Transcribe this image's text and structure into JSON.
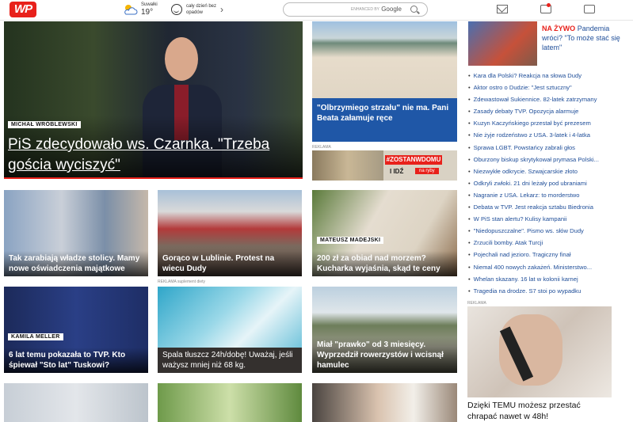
{
  "header": {
    "weather_city": "Suwałki",
    "weather_temp": "19°",
    "weather_desc": "cały dzień bez opadów",
    "search_powered": "ENHANCED BY",
    "search_engine": "Google"
  },
  "colors": {
    "brand": "#e8211b",
    "link": "#1f4e99",
    "caption_blue": "#1f57a7"
  },
  "icons": [
    "wp-logo",
    "weather-sun-cloud-icon",
    "smile-icon",
    "chevron-right-icon",
    "search-icon",
    "mail-icon",
    "notification-icon",
    "tv-icon"
  ],
  "brand": {
    "logo": "WP"
  },
  "hero": {
    "author": "MICHAŁ WRÓBLEWSKI",
    "title": "PiS zdecydowało ws. Czarnka. \"Trzeba gościa wyciszyć\""
  },
  "beach": {
    "caption": "\"Olbrzymiego strzału\" nie ma. Pani Beata załamuje ręce"
  },
  "ad_banner": {
    "reklama": "REKLAMA",
    "hashtag": "#ZOSTANWDOMU",
    "text": "I IDŹ",
    "cta": "na ryby"
  },
  "live": {
    "label": "NA ŻYWO",
    "text": "Pandemia wróci? \"To może stać się latem\""
  },
  "right_news": [
    "Kara dla Polski? Reakcja na słowa Dudy",
    "Aktor ostro o Dudzie: \"Jest sztuczny\"",
    "Zdewastował Sukiennice. 82-latek zatrzymany",
    "Zasady debaty TVP. Opozycja alarmuje",
    "Kuzyn Kaczyńskiego przestał być prezesem",
    "Nie żyje rodzeństwo z USA. 3-latek i 4-latka",
    "Sprawa LGBT. Powstańcy zabrali głos",
    "Oburzony biskup skrytykował prymasa Polski...",
    "Niezwykłe odkrycie. Szwajcarskie złoto",
    "Odkryli zwłoki. 21 dni leżały pod ubraniami",
    "Nagranie z USA. Lekarz: to morderstwo",
    "Debata w TVP. Jest reakcja sztabu Biedronia",
    "W PiS stan alertu? Kulisy kampanii",
    "\"Niedopuszczalne\". Pismo ws. słów Dudy",
    "Zrzucili bomby. Atak Turcji",
    "Pojechali nad jezioro. Tragiczny finał",
    "Niemal 400 nowych zakażeń. Ministerstwo...",
    "Whelan skazany. 16 lat w kolonii karnej",
    "Tragedia na drodze. S7 stoi po wypadku"
  ],
  "right_reklama": "REKLAMA",
  "right_ad_caption": "Dzięki TEMU możesz przestać chrapać nawet w 48h!",
  "row2": [
    {
      "caption": "Tak zarabiają władze stolicy. Mamy nowe oświadczenia majątkowe"
    },
    {
      "caption": "Gorąco w Lublinie. Protest na wiecu Dudy"
    },
    {
      "author": "MATEUSZ MADEJSKI",
      "caption": "200 zł za obiad nad morzem? Kucharka wyjaśnia, skąd te ceny"
    }
  ],
  "row3": [
    {
      "author": "KAMILA MELLER",
      "caption": "6 lat temu pokazała to TVP. Kto śpiewał \"Sto lat\" Tuskowi?"
    },
    {
      "reklama": "REKLAMA suplement diety",
      "caption": "Spala tłuszcz 24h/dobę! Uważaj, jeśli ważysz mniej niż 68 kg."
    },
    {
      "caption": "Miał \"prawko\" od 3 miesięcy. Wyprzedził rowerzystów i wcisnął hamulec"
    }
  ]
}
